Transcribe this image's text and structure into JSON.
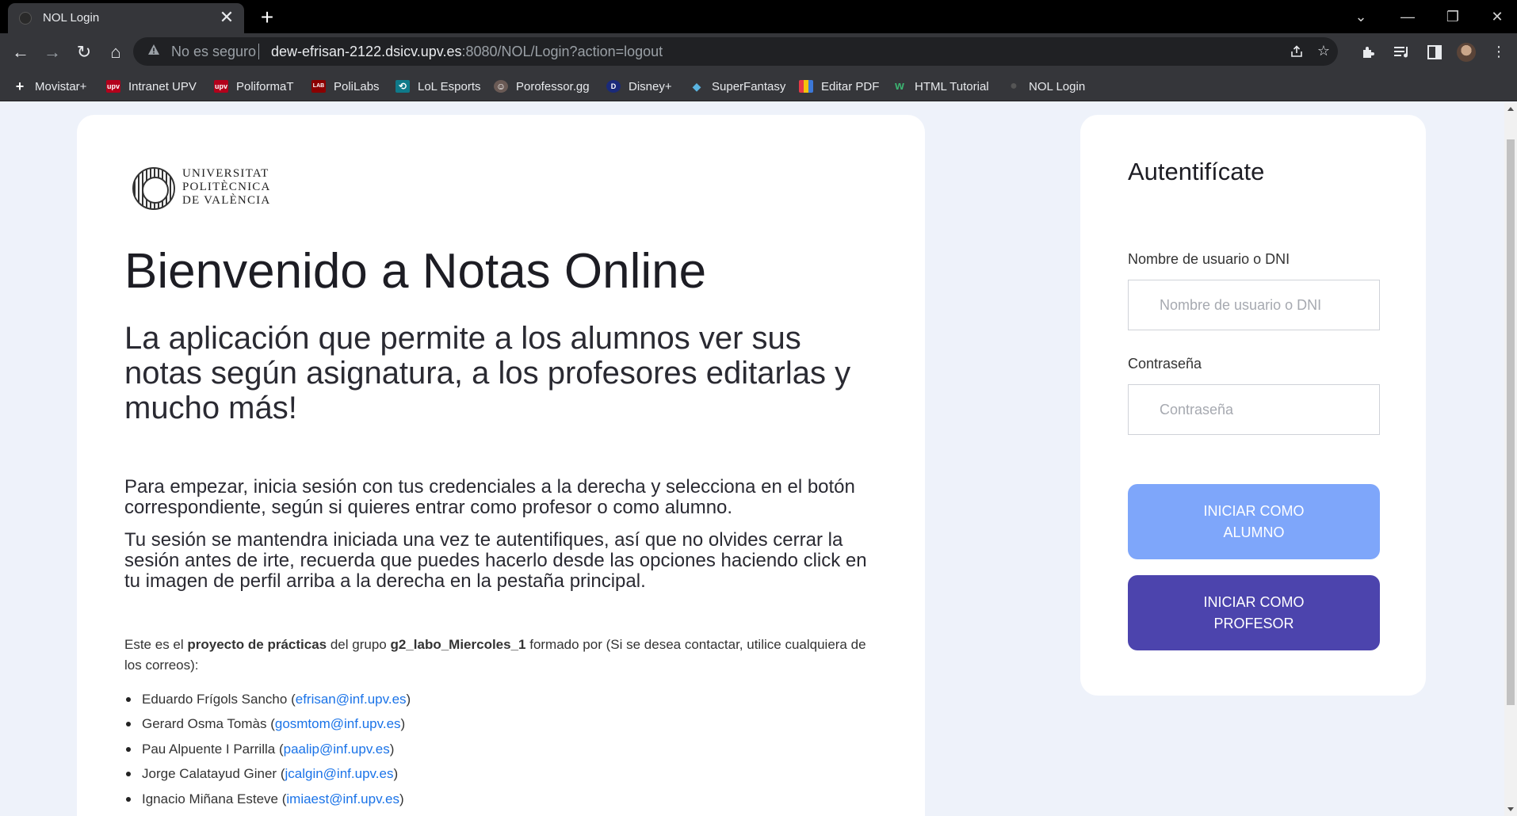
{
  "browser": {
    "tab": {
      "title": "NOL Login",
      "close_icon": "✕"
    },
    "new_tab_icon": "+",
    "window_controls": {
      "tab_search": "⌄",
      "minimize": "—",
      "restore": "❐",
      "close": "✕"
    },
    "nav": {
      "back": "←",
      "forward": "→",
      "reload": "↻",
      "home": "⌂"
    },
    "omnibox": {
      "security_label": "No es seguro",
      "host": "dew-efrisan-2122.dsicv.upv.es",
      "path": ":8080/NOL/Login?action=logout"
    },
    "bookmarks": [
      {
        "label": "Movistar+",
        "icon": "+",
        "color": "#111111"
      },
      {
        "label": "Intranet UPV",
        "icon": "upv",
        "color": "#b3001b"
      },
      {
        "label": "PoliformaT",
        "icon": "upv",
        "color": "#b3001b"
      },
      {
        "label": "PoliLabs",
        "icon": "LAB",
        "color": "#8b0000"
      },
      {
        "label": "LoL Esports",
        "icon": "⟲",
        "color": "#0f7a8a"
      },
      {
        "label": "Porofessor.gg",
        "icon": "☺",
        "color": "#6a5a55"
      },
      {
        "label": "Disney+",
        "icon": "D",
        "color": "#1a2a7a"
      },
      {
        "label": "SuperFantasy",
        "icon": "◆",
        "color": "#2e7fa3"
      },
      {
        "label": "Editar PDF",
        "icon": "▦",
        "color": "#d04a9a"
      },
      {
        "label": "HTML Tutorial",
        "icon": "w",
        "color": "#2e8b57"
      },
      {
        "label": "NOL Login",
        "icon": "●",
        "color": "#333333"
      }
    ]
  },
  "page": {
    "logo_lines": [
      "UNIVERSITAT",
      "POLITÈCNICA",
      "DE VALÈNCIA"
    ],
    "title": "Bienvenido a Notas Online",
    "subtitle": "La aplicación que permite a los alumnos ver sus notas según asignatura, a los profesores editarlas y mucho más!",
    "intro_1": "Para empezar, inicia sesión con tus credenciales a la derecha y selecciona en el botón correspondiente, según si quieres entrar como profesor o como alumno.",
    "intro_2": "Tu sesión se mantendra iniciada una vez te autentifiques, así que no olvides cerrar la sesión antes de irte, recuerda que puedes hacerlo desde las opciones haciendo click en tu imagen de perfil arriba a la derecha en la pestaña principal.",
    "project": {
      "prefix": "Este es el ",
      "bold_1": "proyecto de prácticas",
      "middle": " del grupo ",
      "bold_2": "g2_labo_Miercoles_1",
      "suffix": " formado por (Si se desea contactar, utilice cualquiera de los correos):"
    },
    "members": [
      {
        "name": "Eduardo Frígols Sancho",
        "email": "efrisan@inf.upv.es"
      },
      {
        "name": "Gerard Osma Tomàs",
        "email": "gosmtom@inf.upv.es"
      },
      {
        "name": "Pau Alpuente I Parrilla",
        "email": "paalip@inf.upv.es"
      },
      {
        "name": "Jorge Calatayud Giner",
        "email": "jcalgin@inf.upv.es"
      },
      {
        "name": "Ignacio Miñana Esteve",
        "email": "imiaest@inf.upv.es"
      }
    ]
  },
  "auth": {
    "title": "Autentifícate",
    "username_label": "Nombre de usuario o DNI",
    "username_placeholder": "Nombre de usuario o DNI",
    "username_value": "",
    "password_label": "Contraseña",
    "password_placeholder": "Contraseña",
    "password_value": "",
    "student_button": "INICIAR COMO ALUMNO",
    "teacher_button": "INICIAR COMO PROFESOR",
    "colors": {
      "student": "#7ea6fa",
      "teacher": "#4c44ad"
    }
  }
}
